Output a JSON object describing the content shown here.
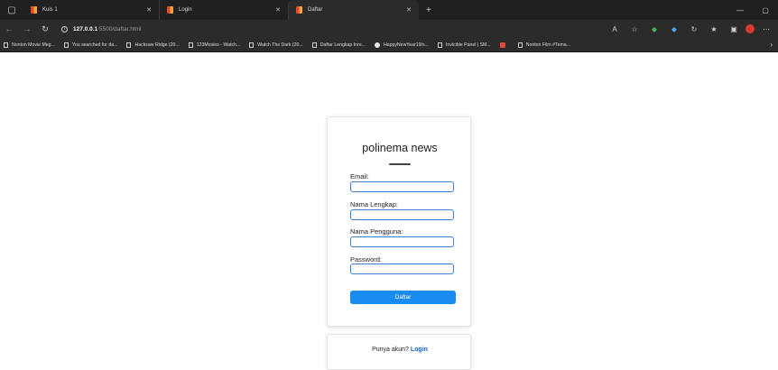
{
  "browser": {
    "tabs": [
      {
        "label": "Kuis 1",
        "active": false
      },
      {
        "label": "Login",
        "active": false
      },
      {
        "label": "Daftar",
        "active": true
      }
    ],
    "new_tab_symbol": "+",
    "window_controls": [
      "—",
      "▢"
    ],
    "address": {
      "host": "127.0.0.1",
      "path": ":5500/daftar.html"
    },
    "bookmarks": [
      {
        "label": "Nonton Movie Meg...",
        "icon": "page-icon"
      },
      {
        "label": "You searched for da...",
        "icon": "page-icon"
      },
      {
        "label": "Hacksaw Ridge (20...",
        "icon": "page-icon"
      },
      {
        "label": "123Movies - Watch...",
        "icon": "page-icon"
      },
      {
        "label": "Watch The Dark (20...",
        "icon": "page-icon"
      },
      {
        "label": "Daftar Lengkap Inre...",
        "icon": "page-icon"
      },
      {
        "label": "HappyNewYear19/s...",
        "icon": "github-icon"
      },
      {
        "label": "Invicible Panel | SM...",
        "icon": "page-icon"
      },
      {
        "label": "",
        "icon": "pdf-icon"
      },
      {
        "label": "Nonton Film #Tema...",
        "icon": "page-icon"
      }
    ]
  },
  "form": {
    "title": "polinema news",
    "fields": [
      {
        "label": "Email:",
        "value": ""
      },
      {
        "label": "Nama Lengkap:",
        "value": ""
      },
      {
        "label": "Nama Pengguna:",
        "value": ""
      },
      {
        "label": "Password:",
        "value": ""
      }
    ],
    "submit_label": "Daftar"
  },
  "login_prompt": {
    "text": "Punya akun? ",
    "link_label": "Login"
  },
  "colors": {
    "accent": "#1a8cf0",
    "field_border": "#3d7fd6",
    "link": "#1560c9"
  }
}
